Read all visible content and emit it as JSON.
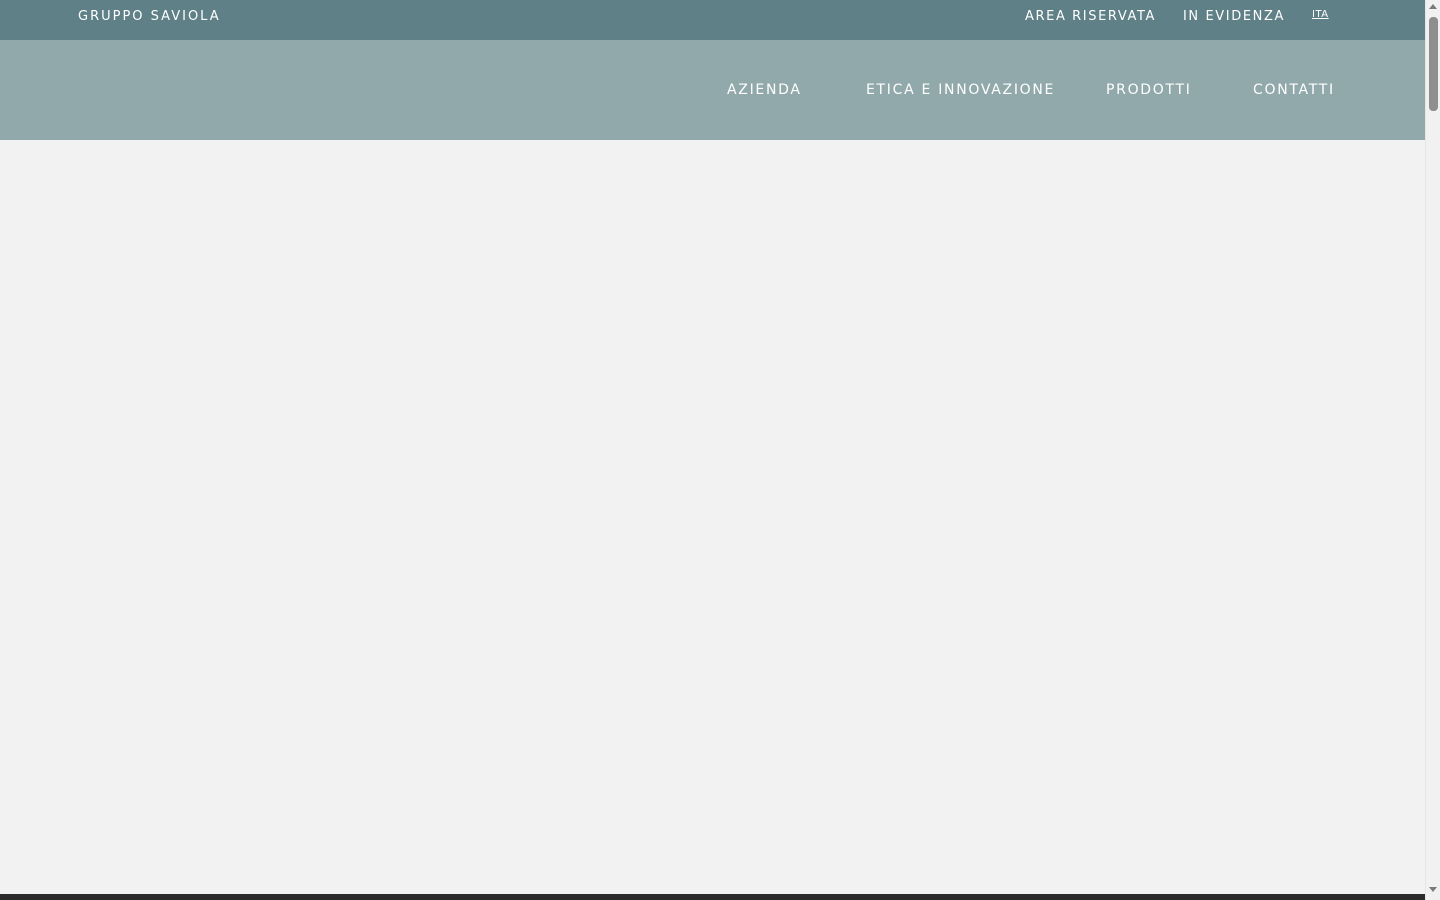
{
  "topbar": {
    "brand": "GRUPPO SAVIOLA",
    "links": [
      "AREA RISERVATA",
      "IN EVIDENZA"
    ],
    "language": "ITA"
  },
  "nav": {
    "items": [
      "AZIENDA",
      "ETICA E INNOVAZIONE",
      "PRODOTTI",
      "CONTATTI"
    ]
  },
  "colors": {
    "topbar_bg": "#5f8087",
    "nav_bg": "#91a9aa",
    "page_bg": "#f2f2f2",
    "text": "#ffffff"
  }
}
